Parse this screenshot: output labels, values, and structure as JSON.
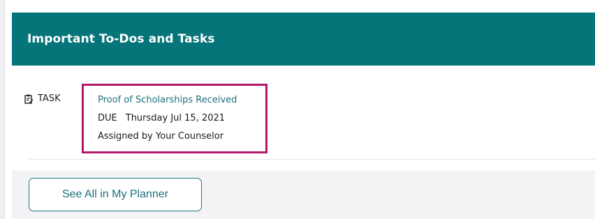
{
  "card": {
    "title": "Important To-Dos and Tasks"
  },
  "task": {
    "type_label": "TASK",
    "type_icon": "clipboard-edit-icon",
    "title": "Proof of Scholarships Received",
    "due_label": "DUE",
    "due_date": "Thursday Jul 15, 2021",
    "assigned_by": "Assigned by Your Counselor"
  },
  "footer": {
    "button_label": "See All in My Planner"
  },
  "colors": {
    "header_bg": "#05757a",
    "link_teal": "#1c6f7d",
    "highlight_border": "#b5176b",
    "footer_bg": "#f3f3f6"
  }
}
